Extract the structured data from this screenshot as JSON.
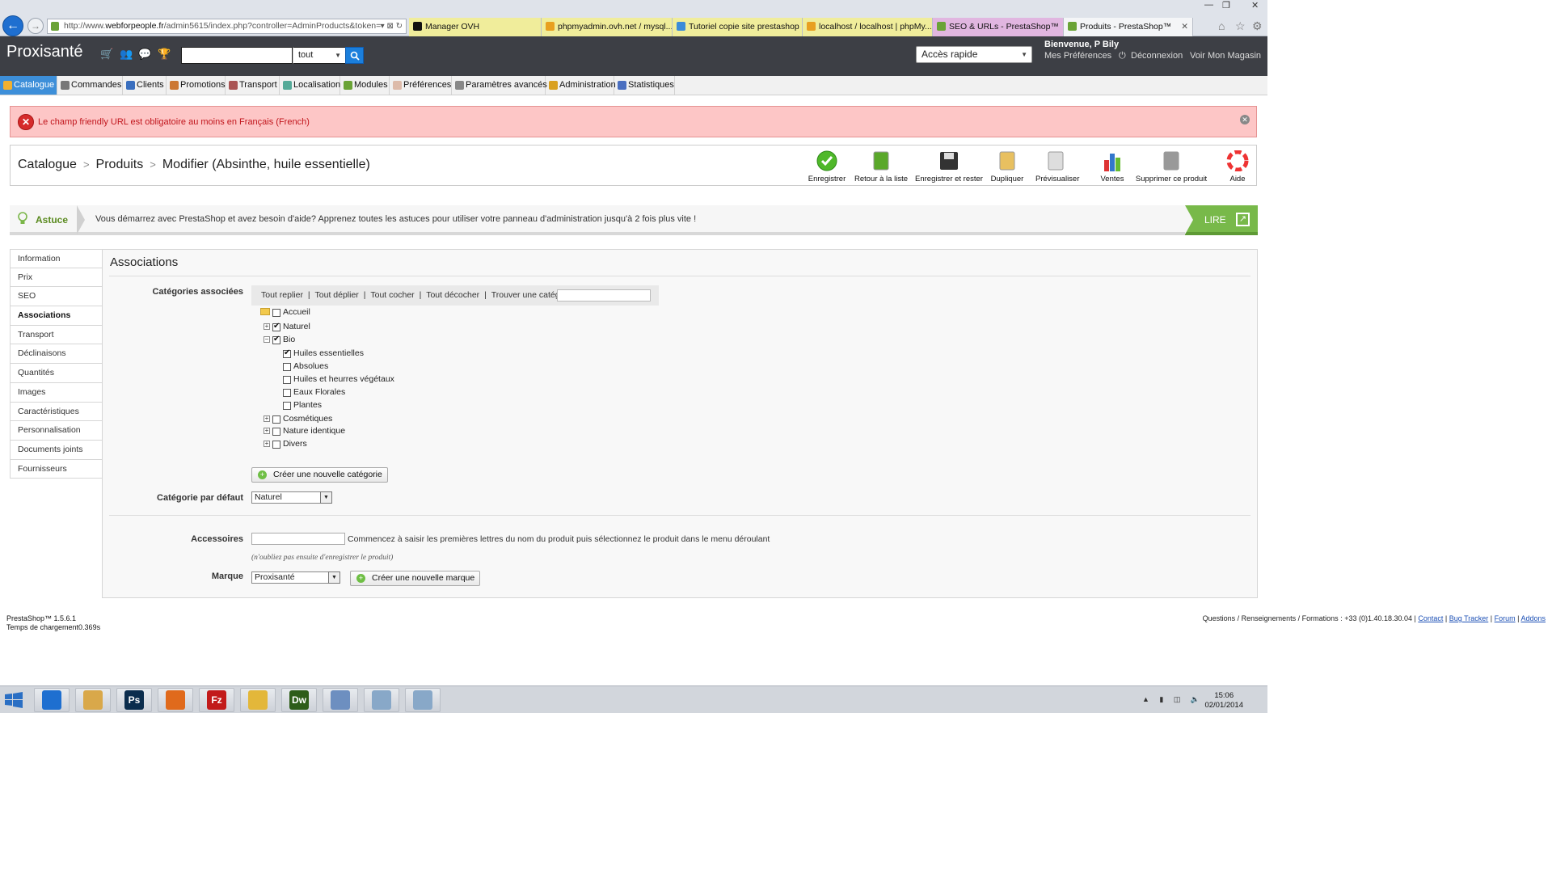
{
  "browser": {
    "url_prefix": "http://www.",
    "url_domain": "webforpeople.fr",
    "url_path": "/admin5615/index.php?controller=AdminProducts&token=",
    "tabs": [
      {
        "label": "Manager OVH",
        "color": "#111"
      },
      {
        "label": "phpmyadmin.ovh.net / mysql...",
        "color": "#e8a020"
      },
      {
        "label": "Tutoriel copie site prestashop ...",
        "color": "#3a8bd8"
      },
      {
        "label": "localhost / localhost | phpMy...",
        "color": "#e8a020"
      },
      {
        "label": "SEO & URLs - PrestaShop™",
        "color": "#6aa336"
      },
      {
        "label": "Produits - PrestaShop™",
        "color": "#6aa336"
      }
    ]
  },
  "header": {
    "brand": "Proxisanté",
    "search_scope": "tout",
    "quick_access": "Accès rapide",
    "welcome": "Bienvenue, P Bily",
    "prefs": "Mes Préférences",
    "logout": "Déconnexion",
    "shop": "Voir Mon Magasin"
  },
  "menu": [
    {
      "label": "Catalogue",
      "color": "#f0b030"
    },
    {
      "label": "Commandes",
      "color": "#777"
    },
    {
      "label": "Clients",
      "color": "#3a6fbf"
    },
    {
      "label": "Promotions",
      "color": "#c73"
    },
    {
      "label": "Transport",
      "color": "#a55"
    },
    {
      "label": "Localisation",
      "color": "#5a9"
    },
    {
      "label": "Modules",
      "color": "#6aa336"
    },
    {
      "label": "Préférences",
      "color": "#dba"
    },
    {
      "label": "Paramètres avancés",
      "color": "#888"
    },
    {
      "label": "Administration",
      "color": "#d9a020"
    },
    {
      "label": "Statistiques",
      "color": "#4a6fc0"
    }
  ],
  "error": {
    "message": "Le champ friendly URL est obligatoire au moins en Français (French)"
  },
  "breadcrumb": {
    "a": "Catalogue",
    "b": "Produits",
    "c": "Modifier (Absinthe, huile essentielle)"
  },
  "toolbar": [
    {
      "label": "Enregistrer",
      "color": "#4fb82a"
    },
    {
      "label": "Retour à la liste",
      "color": "#5aa82a"
    },
    {
      "label": "Enregistrer et rester",
      "color": "#333"
    },
    {
      "label": "Dupliquer",
      "color": "#e8c060"
    },
    {
      "label": "Prévisualiser",
      "color": "#ddd"
    },
    {
      "label": "Ventes",
      "color": "#d33"
    },
    {
      "label": "Supprimer ce produit",
      "color": "#999"
    },
    {
      "label": "Aide",
      "color": "#e33"
    }
  ],
  "tip": {
    "label": "Astuce",
    "text": "Vous démarrez avec PrestaShop et avez besoin d'aide? Apprenez toutes les astuces pour utiliser votre panneau d'administration jusqu'à 2 fois plus vite !",
    "button": "LIRE"
  },
  "sidebar": [
    "Information",
    "Prix",
    "SEO",
    "Associations",
    "Transport",
    "Déclinaisons",
    "Quantités",
    "Images",
    "Caractéristiques",
    "Personnalisation",
    "Documents joints",
    "Fournisseurs"
  ],
  "panel": {
    "title": "Associations",
    "cat_label": "Catégories associées",
    "tools": [
      "Tout replier",
      "Tout déplier",
      "Tout cocher",
      "Tout décocher"
    ],
    "find_label": "Trouver une catégorie:",
    "tree": [
      {
        "label": "Accueil",
        "checked": false
      },
      {
        "label": "Naturel",
        "checked": true
      },
      {
        "label": "Bio",
        "checked": true
      },
      {
        "label": "Huiles essentielles",
        "checked": true
      },
      {
        "label": "Absolues",
        "checked": false
      },
      {
        "label": "Huiles et heurres végétaux",
        "checked": false
      },
      {
        "label": "Eaux Florales",
        "checked": false
      },
      {
        "label": "Plantes",
        "checked": false
      },
      {
        "label": "Cosmétiques",
        "checked": false
      },
      {
        "label": "Nature identique",
        "checked": false
      },
      {
        "label": "Divers",
        "checked": false
      }
    ],
    "new_cat_btn": "Créer une nouvelle catégorie",
    "default_cat_label": "Catégorie par défaut",
    "default_cat_value": "Naturel",
    "acc_label": "Accessoires",
    "acc_help": "Commencez à saisir les premières lettres du nom du produit puis sélectionnez le produit dans le menu déroulant",
    "acc_note": "(n'oubliez pas ensuite d'enregistrer le produit)",
    "brand_label": "Marque",
    "brand_value": "Proxisanté",
    "new_brand_btn": "Créer une nouvelle marque"
  },
  "footer": {
    "version": "PrestaShop™ 1.5.6.1",
    "load_time": "Temps de chargement0.369s",
    "contact_text": "Questions / Renseignements / Formations : +33 (0)1.40.18.30.04 |",
    "links": [
      "Contact",
      "Bug Tracker",
      "Forum",
      "Addons"
    ]
  },
  "taskbar": {
    "apps": [
      {
        "label": "",
        "color": "#1e6fd0"
      },
      {
        "label": "",
        "color": "#d9a84a"
      },
      {
        "label": "Ps",
        "color": "#0b2d4d"
      },
      {
        "label": "",
        "color": "#e06a1c"
      },
      {
        "label": "Fz",
        "color": "#c21b1b"
      },
      {
        "label": "",
        "color": "#e3b73a"
      },
      {
        "label": "Dw",
        "color": "#2e5d19"
      },
      {
        "label": "",
        "color": "#6d8fc0"
      },
      {
        "label": "",
        "color": "#88a8c8"
      },
      {
        "label": "",
        "color": "#88a8c8"
      }
    ],
    "time": "15:06",
    "date": "02/01/2014"
  }
}
